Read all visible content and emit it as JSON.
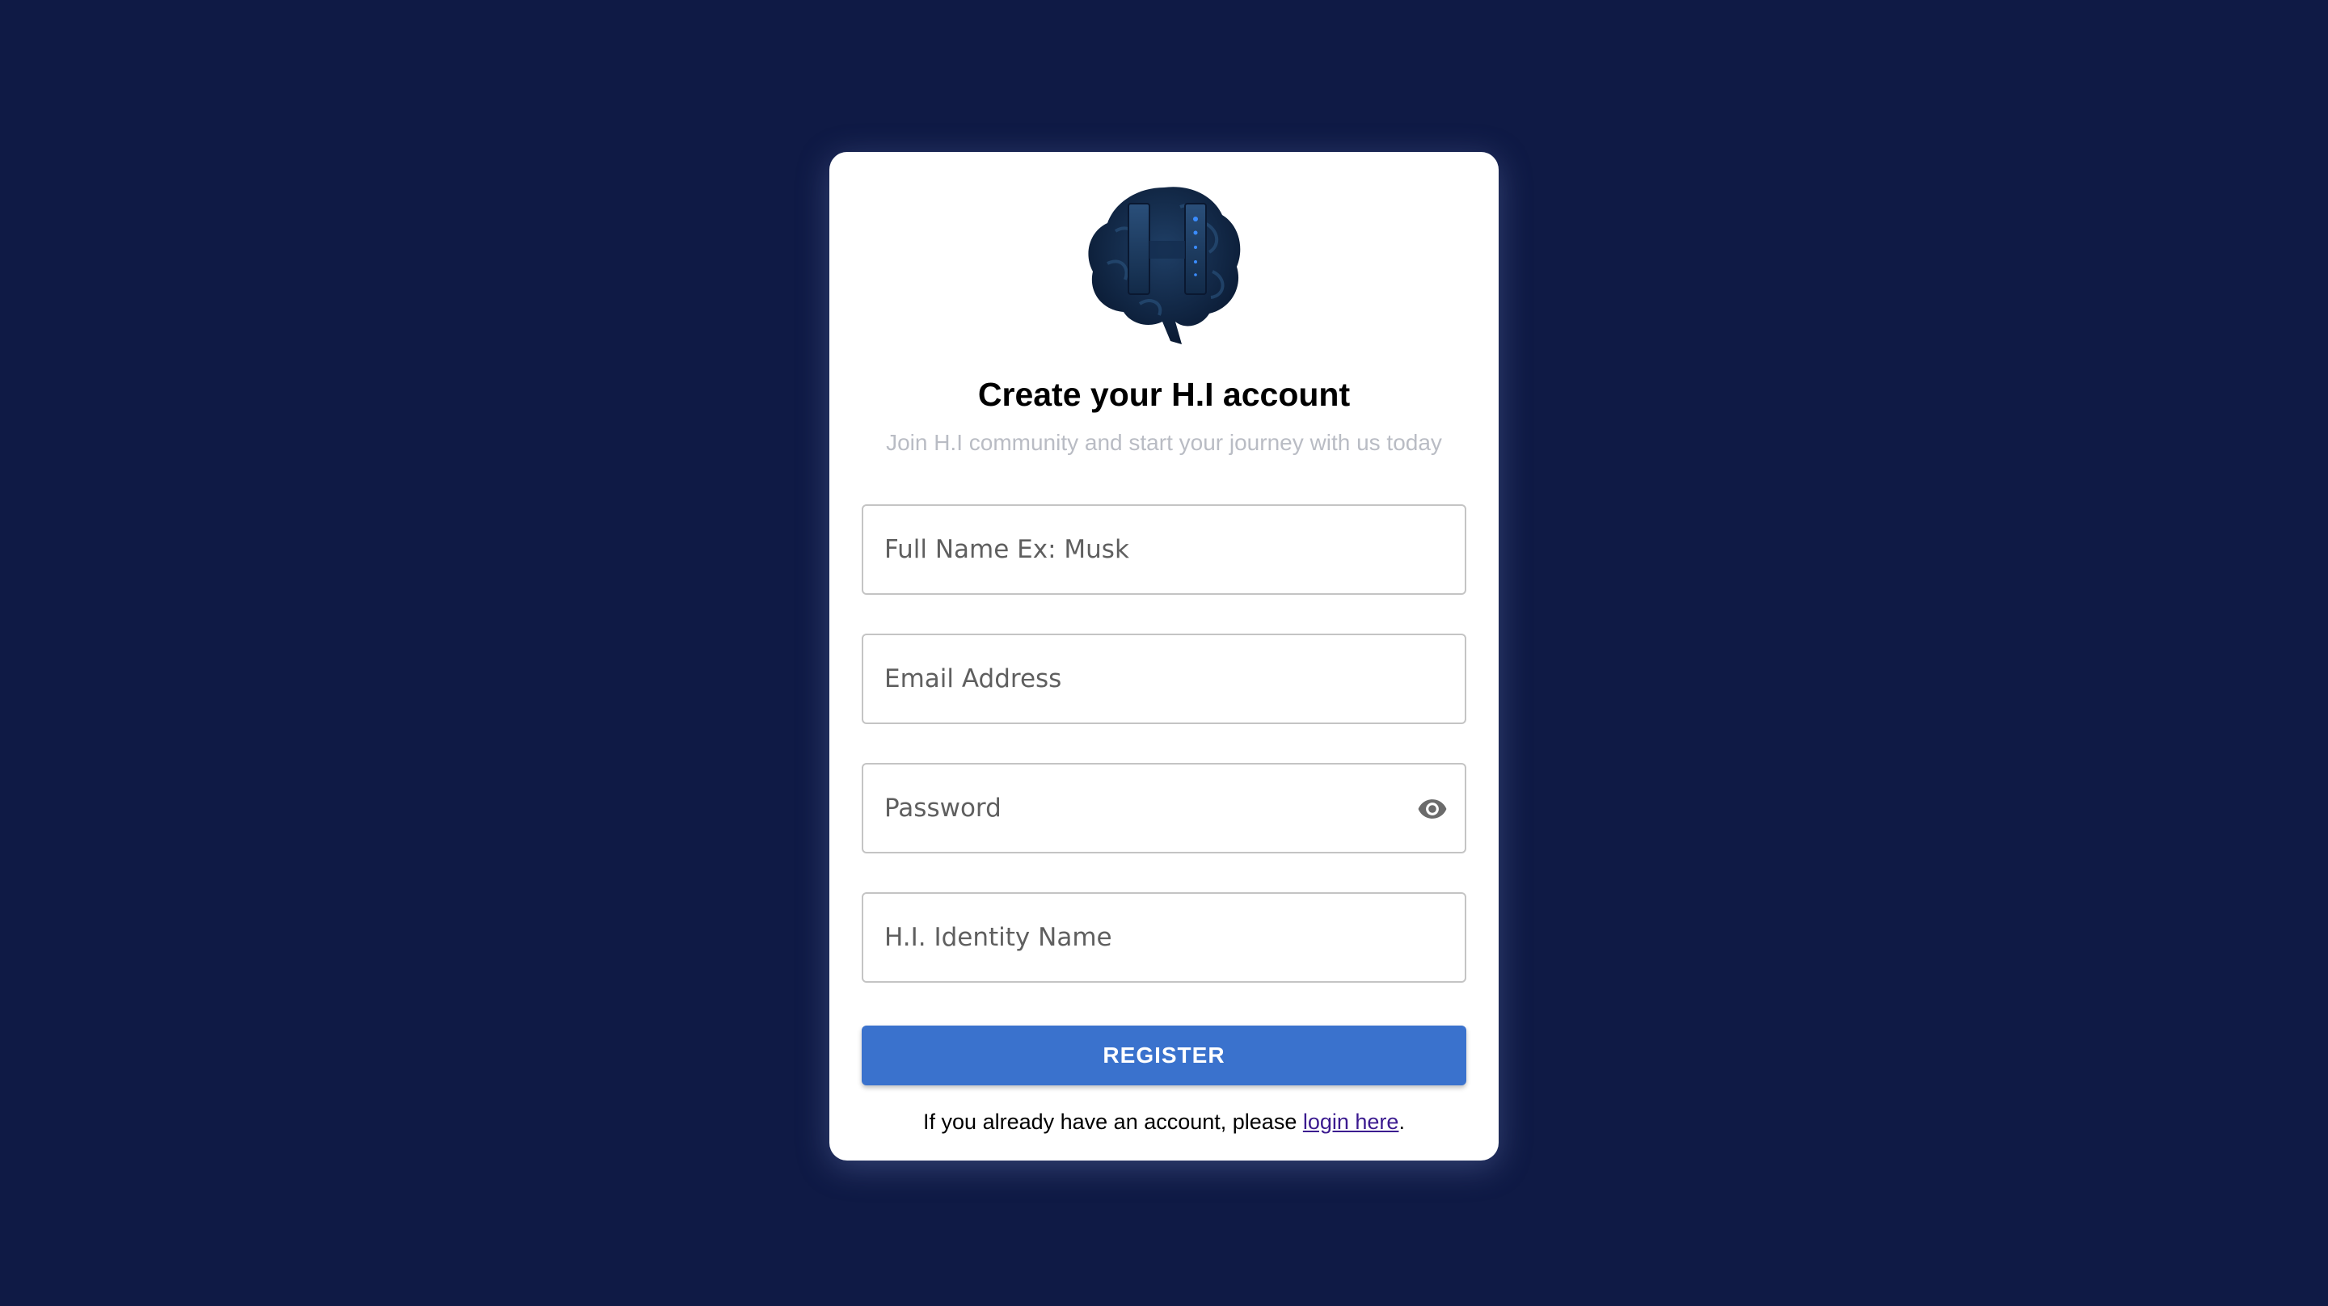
{
  "colors": {
    "page_background": "#0f1a45",
    "card_background": "#ffffff",
    "primary_button": "#3a72cd",
    "link": "#3b1a8f",
    "subtitle": "#b9bcc4"
  },
  "logo": {
    "icon": "brain-hi-logo"
  },
  "header": {
    "title": "Create your H.I account",
    "subtitle": "Join H.I community and start your journey with us today"
  },
  "form": {
    "full_name": {
      "placeholder": "Full Name Ex: Musk",
      "value": ""
    },
    "email": {
      "placeholder": "Email Address",
      "value": ""
    },
    "password": {
      "placeholder": "Password",
      "value": "",
      "toggle_icon": "eye-icon"
    },
    "identity_name": {
      "placeholder": "H.I. Identity Name",
      "value": ""
    },
    "register_label": "REGISTER"
  },
  "footer": {
    "prefix": "If you already have an account, please ",
    "link_label": "login here",
    "suffix": "."
  }
}
